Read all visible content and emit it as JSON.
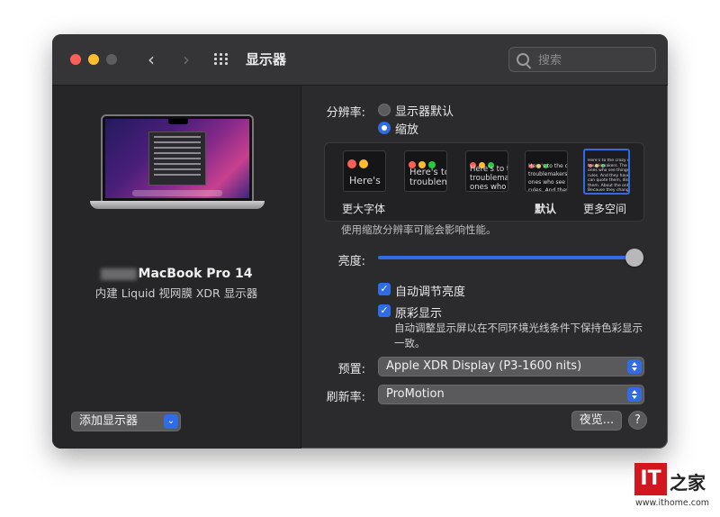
{
  "window": {
    "title": "显示器"
  },
  "search": {
    "placeholder": "搜索"
  },
  "sidebar": {
    "device_name": "MacBook Pro 14",
    "device_subtitle": "内建 Liquid 视网膜 XDR 显示器",
    "add_display_label": "添加显示器"
  },
  "resolution": {
    "label": "分辨率:",
    "options": [
      {
        "label": "显示器默认",
        "selected": false
      },
      {
        "label": "缩放",
        "selected": true
      }
    ],
    "scaled_choices": [
      {
        "label": "更大字体",
        "preview": "Here's",
        "selected": false
      },
      {
        "label": "",
        "preview": "Here's to\ntroublem",
        "selected": false
      },
      {
        "label": "",
        "preview": "Here's to t\ntroublema\nones who",
        "selected": false
      },
      {
        "label": "默认",
        "preview": "Here's to the cr\ntroublemakers.\nones who see t\nrules. And they",
        "selected": false
      },
      {
        "label": "更多空间",
        "preview": "Here's to the crazy one\ntroublemakers. The rou\nones who see things dif\nrules. And they have no\ncan quote them, disagre\nthem. About the only th\nBecause they change th",
        "selected": true
      }
    ],
    "note": "使用缩放分辨率可能会影响性能。"
  },
  "brightness": {
    "label": "亮度:",
    "value": 1.0
  },
  "auto_brightness": {
    "label": "自动调节亮度",
    "checked": true
  },
  "true_tone": {
    "label": "原彩显示",
    "checked": true,
    "description": "自动调整显示屏以在不同环境光线条件下保持色彩显示一致。"
  },
  "preset": {
    "label": "预置:",
    "value": "Apple XDR Display (P3-1600 nits)"
  },
  "refresh_rate": {
    "label": "刷新率:",
    "value": "ProMotion"
  },
  "night_shift_label": "夜览...",
  "help_label": "?",
  "watermark": {
    "brand": "IT",
    "char": "之家",
    "url": "www.ithome.com"
  },
  "colors": {
    "accent": "#2f6ce5",
    "close": "#fe5f57",
    "minimize": "#febc2e"
  }
}
